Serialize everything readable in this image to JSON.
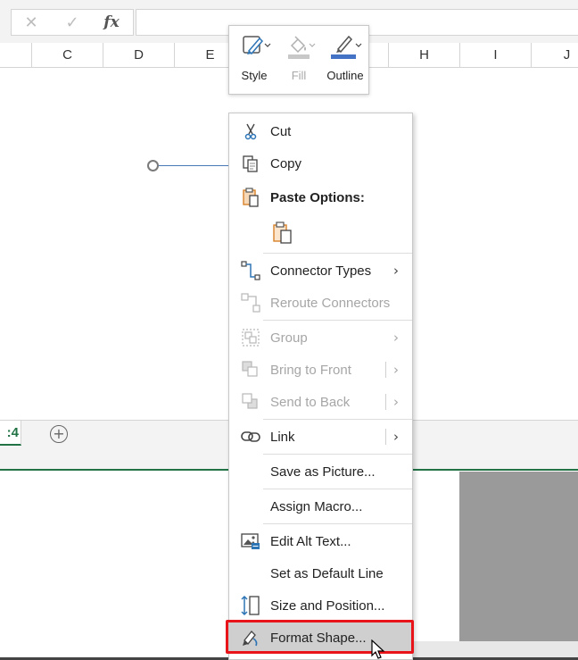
{
  "formula_bar": {
    "cancel_symbol": "✕",
    "enter_symbol": "✓",
    "fx_symbol": "fx",
    "value": ""
  },
  "columns": [
    "C",
    "D",
    "E",
    "H",
    "I",
    "J"
  ],
  "sheet_tabs": {
    "active_tab_fragment": ":4",
    "add_symbol": "+"
  },
  "mini_toolbar": {
    "style_label": "Style",
    "fill_label": "Fill",
    "outline_label": "Outline",
    "outline_color": "#4472c4"
  },
  "context_menu": {
    "items": [
      {
        "label": "Cut",
        "icon": "scissors-icon"
      },
      {
        "label": "Copy",
        "icon": "copy-icon"
      },
      {
        "label": "Paste Options:",
        "icon": "paste-icon"
      },
      {
        "label": "Connector Types",
        "icon": "connector-types-icon",
        "submenu": "›"
      },
      {
        "label": "Reroute Connectors",
        "icon": "reroute-icon",
        "disabled": true
      },
      {
        "label": "Group",
        "icon": "group-icon",
        "disabled": true,
        "submenu": "›"
      },
      {
        "label": "Bring to Front",
        "icon": "bring-front-icon",
        "disabled": true,
        "submenu": "›"
      },
      {
        "label": "Send to Back",
        "icon": "send-back-icon",
        "disabled": true,
        "submenu": "›"
      },
      {
        "label": "Link",
        "icon": "link-icon",
        "submenu": "›"
      },
      {
        "label": "Save as Picture...",
        "icon": ""
      },
      {
        "label": "Assign Macro...",
        "icon": ""
      },
      {
        "label": "Edit Alt Text...",
        "icon": "alt-text-icon"
      },
      {
        "label": "Set as Default Line",
        "icon": ""
      },
      {
        "label": "Size and Position...",
        "icon": "size-position-icon"
      },
      {
        "label": "Format Shape...",
        "icon": "format-shape-icon"
      }
    ]
  },
  "colors": {
    "excel_green": "#217346",
    "highlight_red": "#e8141a",
    "icon_blue": "#2e75b6",
    "icon_orange": "#d9822b"
  }
}
